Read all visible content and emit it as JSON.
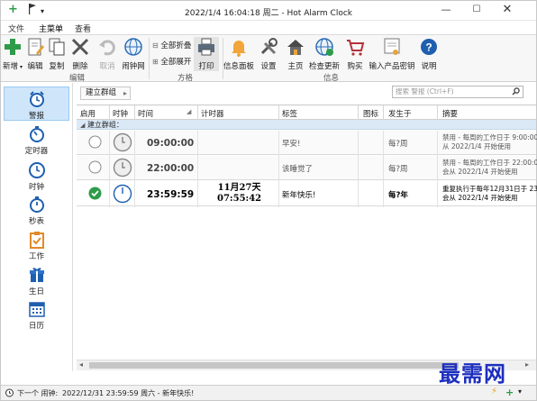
{
  "window": {
    "title": "2022/1/4 16:04:18 周二 - Hot Alarm Clock"
  },
  "tabs": [
    "文件",
    "主菜单",
    "查看"
  ],
  "ribbon": {
    "edit_group": "编辑",
    "buttons": {
      "new": "新增",
      "edit": "编辑",
      "copy": "复制",
      "delete": "删除",
      "cancel": "取消",
      "clocknet": "闹钟网",
      "expand_all": "全部折叠",
      "collapse_all": "全部展开",
      "print": "打印",
      "info_panel": "信息面板",
      "settings": "设置",
      "home": "主页",
      "check_update": "检查更新",
      "buy": "购买",
      "enter_key": "输入产品密钥",
      "help": "说明"
    },
    "groups": {
      "edit": "编辑",
      "format": "方格",
      "info": "信息"
    }
  },
  "leftnav": [
    "警报",
    "定时器",
    "时钟",
    "秒表",
    "工作",
    "生日",
    "日历"
  ],
  "toolbar": {
    "group_button": "建立群组",
    "search_placeholder": "搜索 警报 (Ctrl+F)"
  },
  "grid": {
    "headers": [
      "启用",
      "时钟",
      "时间",
      "计时器",
      "标签",
      "图标",
      "发生于",
      "摘要"
    ],
    "group_label": "建立群组：",
    "rows": [
      {
        "enabled": false,
        "time": "09:00:00",
        "timer": "",
        "label": "早安!",
        "occurs": "每?周",
        "summary1": "禁用 - 每周的工作日于 9:00:00 发",
        "summary2": "从 2022/1/4 开始使用",
        "active": false
      },
      {
        "enabled": false,
        "time": "22:00:00",
        "timer": "",
        "label": "该睡觉了",
        "occurs": "每?周",
        "summary1": "禁用 - 每周的工作日于 22:00:00",
        "summary2": "会从 2022/1/4 开始使用",
        "active": false
      },
      {
        "enabled": true,
        "time": "23:59:59",
        "timer1": "11月27天",
        "timer2": "07:55:42",
        "label": "新年快乐!",
        "occurs": "每?年",
        "summary1": "重复执行于每年12月31日于 23:59:",
        "summary2": "会从 2022/1/4 开始使用",
        "active": true
      }
    ]
  },
  "status": {
    "next_label": "下一个 闹钟:",
    "next_value": "2022/12/31 23:59:59 周六 - 新年快乐!"
  },
  "watermark": "最需网",
  "colors": {
    "accent": "#2b7cd3",
    "selected_nav": "#cfe6fa",
    "group_row": "#dbe9f7",
    "enabled_check": "#2e9b4a"
  }
}
